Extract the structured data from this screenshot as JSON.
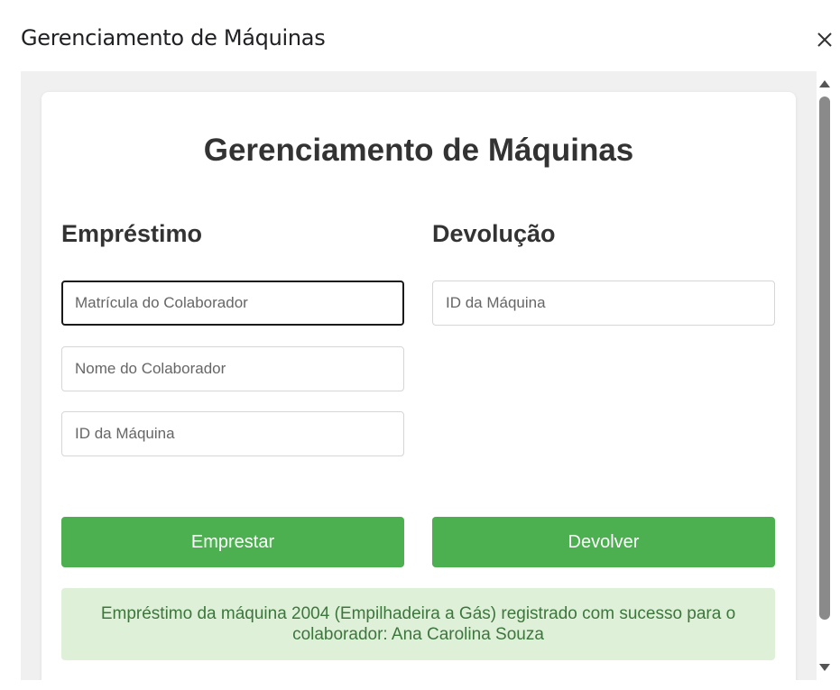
{
  "dialog": {
    "title": "Gerenciamento de Máquinas",
    "close_icon": "close-icon"
  },
  "page": {
    "title": "Gerenciamento de Máquinas"
  },
  "loan": {
    "heading": "Empréstimo",
    "employee_id_placeholder": "Matrícula do Colaborador",
    "employee_id_value": "",
    "employee_name_placeholder": "Nome do Colaborador",
    "employee_name_value": "",
    "machine_id_placeholder": "ID da Máquina",
    "machine_id_value": "",
    "button_label": "Emprestar"
  },
  "return": {
    "heading": "Devolução",
    "machine_id_placeholder": "ID da Máquina",
    "machine_id_value": "",
    "button_label": "Devolver"
  },
  "status": {
    "message": "Empréstimo da máquina 2004 (Empilhadeira a Gás) registrado com sucesso para o colaborador: Ana Carolina Souza"
  },
  "colors": {
    "button": "#4caf50",
    "success_bg": "#dff0d8",
    "success_text": "#3c763d"
  }
}
